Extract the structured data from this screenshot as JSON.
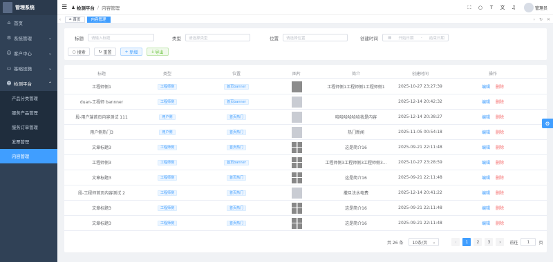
{
  "app": {
    "title": "管理系统"
  },
  "sidebar": {
    "items": [
      {
        "label": "首页",
        "icon": "home-icon"
      },
      {
        "label": "系统管理",
        "icon": "gear-icon"
      },
      {
        "label": "客户中心",
        "icon": "user-icon"
      },
      {
        "label": "基础设施",
        "icon": "monitor-icon"
      },
      {
        "label": "检测平台",
        "icon": "user-icon"
      }
    ],
    "sub_items": [
      "产品分类管理",
      "服务产品管理",
      "服务订单管理",
      "发票管理",
      "内容管理"
    ]
  },
  "header": {
    "breadcrumb": [
      "检测平台",
      "内容管理"
    ],
    "user": "管理员"
  },
  "tags": {
    "items": [
      "首页",
      "内容管理"
    ]
  },
  "filters": {
    "title_label": "标题",
    "title_placeholder": "请输入标题",
    "type_label": "类型",
    "type_placeholder": "请选择类型",
    "position_label": "位置",
    "position_placeholder": "请选择位置",
    "created_label": "创建时间",
    "start_placeholder": "开始日期",
    "end_placeholder": "结束日期",
    "search": "搜索",
    "reset": "重置",
    "add": "新增",
    "export": "导出"
  },
  "table": {
    "headers": [
      "标题",
      "类型",
      "位置",
      "图片",
      "简介",
      "创建时间",
      "操作"
    ],
    "edit_label": "编辑",
    "delete_label": "删除",
    "rows": [
      {
        "title": "工程师侧1",
        "type": "工程师侧",
        "position": "首页banner",
        "image": "grey",
        "intro": "工程师侧1工程师侧1工程师侧1",
        "created": "2025-10-27 23:27:39"
      },
      {
        "title": "duan-工程师 bannner",
        "type": "工程师侧",
        "position": "首页banner",
        "image": "light",
        "intro": "",
        "created": "2025-12-14 20:42:32"
      },
      {
        "title": "段-用户端首页内容测试 111",
        "type": "用户侧",
        "position": "首页热门",
        "image": "light",
        "intro": "哈哈哈哈哈哈我是内容",
        "created": "2025-12-14 20:38:27"
      },
      {
        "title": "用户侧热门3",
        "type": "用户侧",
        "position": "首页热门",
        "image": "light",
        "intro": "热门新闻",
        "created": "2025-11-05 00:54:18"
      },
      {
        "title": "文章标题3",
        "type": "工程师侧",
        "position": "首页热门",
        "image": "grid",
        "intro": "这是简介16",
        "created": "2025-09-21 22:11:48"
      },
      {
        "title": "工程师侧3",
        "type": "工程师侧",
        "position": "首页banner",
        "image": "grid",
        "intro": "工程师侧3工程师侧3工程师侧3...",
        "created": "2025-10-27 23:28:59"
      },
      {
        "title": "文章标题3",
        "type": "工程师侧",
        "position": "首页热门",
        "image": "grid",
        "intro": "这是简介16",
        "created": "2025-09-21 22:11:48"
      },
      {
        "title": "段-工程师首页内容测试 2",
        "type": "工程师侧",
        "position": "首页热门",
        "image": "light",
        "intro": "撒旦法水电费",
        "created": "2025-12-14 20:41:22"
      },
      {
        "title": "文章标题3",
        "type": "工程师侧",
        "position": "首页热门",
        "image": "grid",
        "intro": "这是简介16",
        "created": "2025-09-21 22:11:48"
      },
      {
        "title": "文章标题3",
        "type": "工程师侧",
        "position": "首页热门",
        "image": "grid",
        "intro": "这是简介16",
        "created": "2025-09-21 22:11:48"
      }
    ]
  },
  "pagination": {
    "total": "共 26 条",
    "size": "10条/页",
    "pages": [
      "1",
      "2",
      "3"
    ],
    "goto_label": "前往",
    "goto_value": "1",
    "page_unit": "页"
  },
  "colors": {
    "accent": "#409eff",
    "sidebar": "#304156",
    "danger": "#f56c6c"
  }
}
